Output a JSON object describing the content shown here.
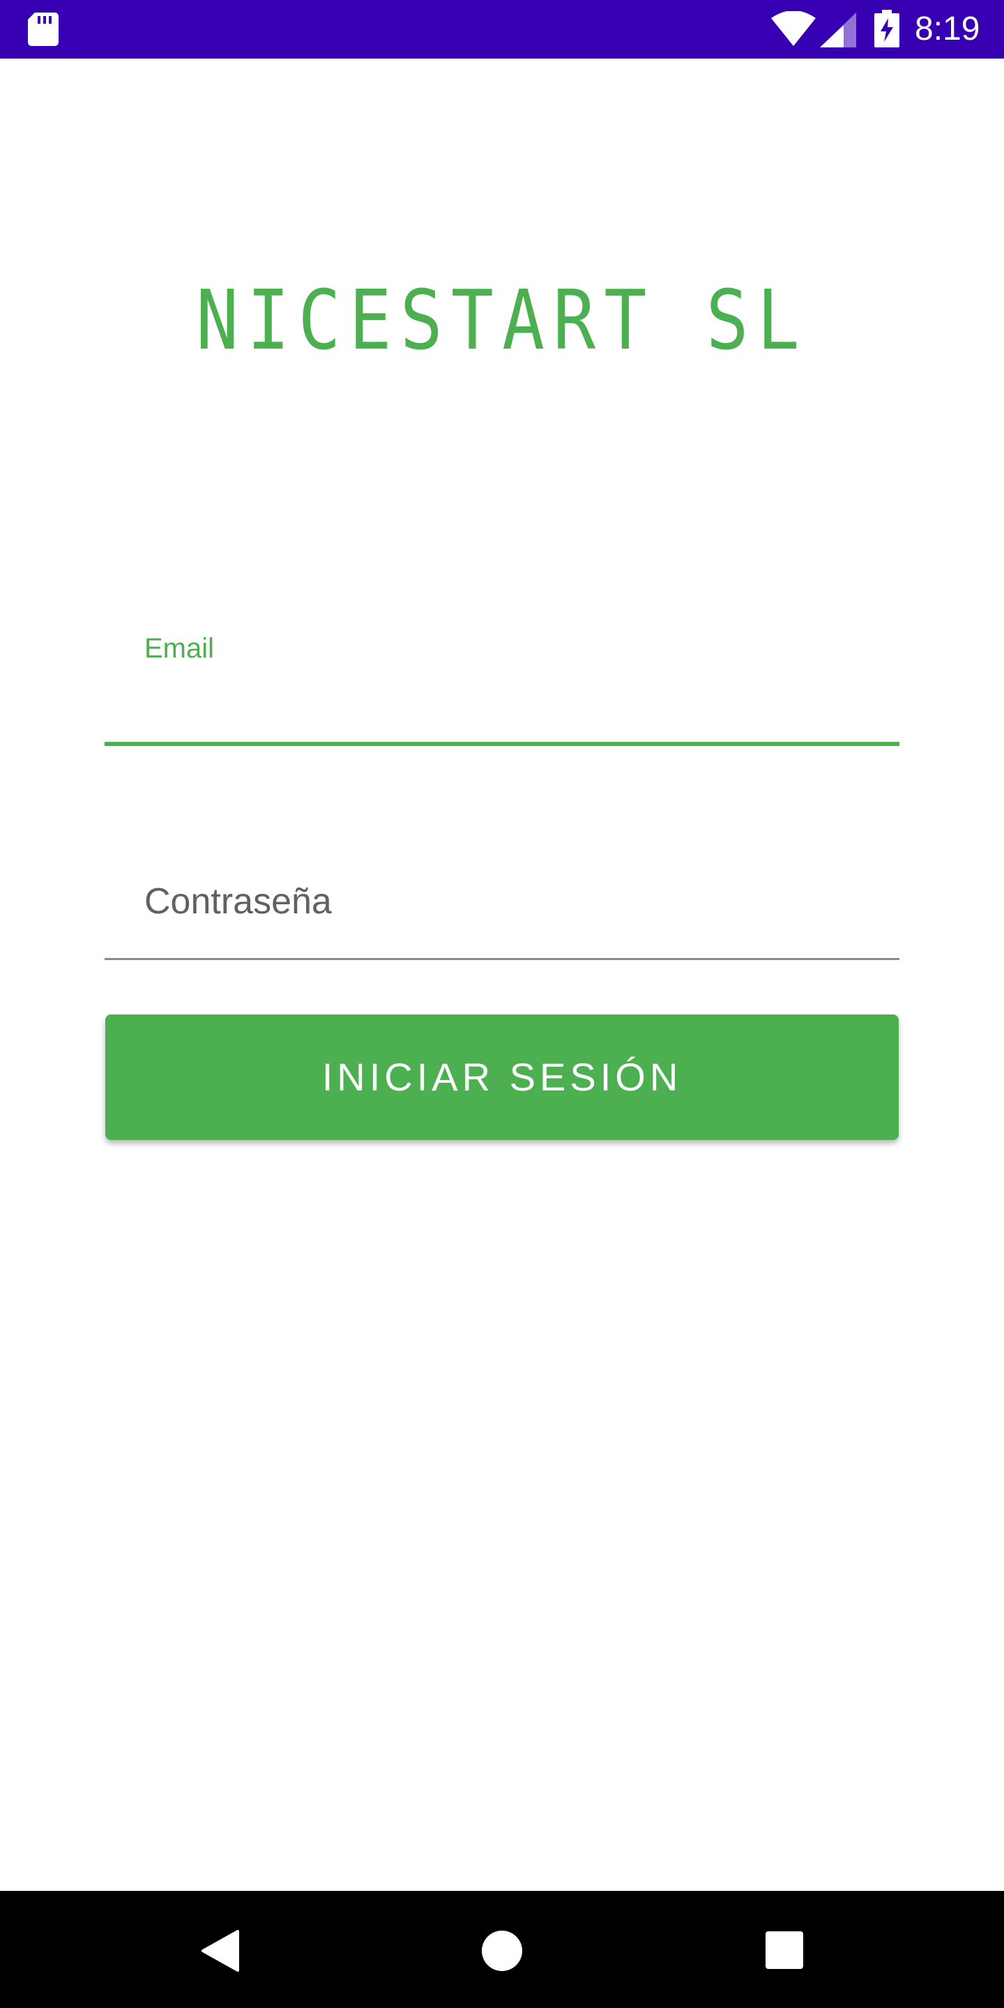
{
  "status_bar": {
    "time": "8:19",
    "background_color": "#3700b3",
    "icons": [
      "sd-card-icon",
      "wifi-icon",
      "signal-icon",
      "battery-charging-icon"
    ]
  },
  "app": {
    "title": "NICESTART SL",
    "accent_color": "#4caf50"
  },
  "form": {
    "email": {
      "label": "Email",
      "value": ""
    },
    "password": {
      "placeholder": "Contraseña",
      "value": ""
    },
    "submit_label": "INICIAR SESIÓN"
  },
  "nav_bar": {
    "icons": [
      "back-icon",
      "home-icon",
      "recents-icon"
    ]
  }
}
